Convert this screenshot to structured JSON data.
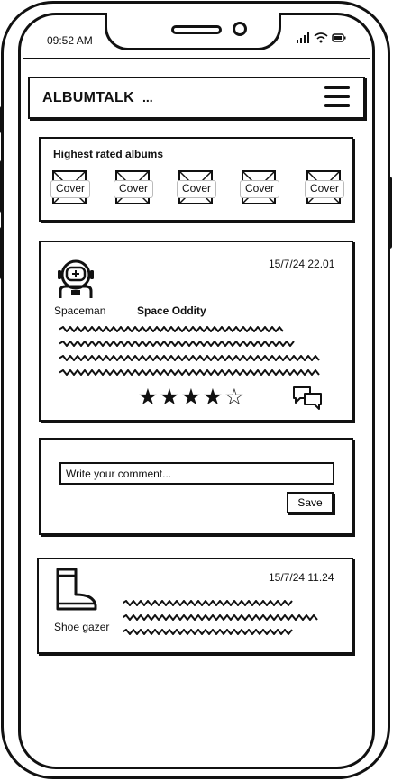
{
  "status_bar": {
    "time": "09:52 AM",
    "icons": [
      "signal-icon",
      "wifi-icon",
      "battery-icon"
    ]
  },
  "header": {
    "title": "ALBUMTALK",
    "ellipsis": "...",
    "menu_icon": "hamburger-menu-icon"
  },
  "highest_rated": {
    "title": "Highest rated albums",
    "covers": [
      "Cover",
      "Cover",
      "Cover",
      "Cover",
      "Cover"
    ]
  },
  "review": {
    "date": "15/7/24 22.01",
    "user": "Spaceman",
    "avatar_icon": "astronaut-icon",
    "album": "Space Oddity",
    "rating": 4,
    "rating_max": 5,
    "comments_icon": "comments-icon"
  },
  "comment_form": {
    "placeholder": "Write your comment...",
    "save_label": "Save"
  },
  "second_review": {
    "date": "15/7/24 11.24",
    "user": "Shoe gazer",
    "avatar_icon": "boot-icon"
  },
  "colors": {
    "ink": "#111111",
    "background": "#ffffff"
  }
}
